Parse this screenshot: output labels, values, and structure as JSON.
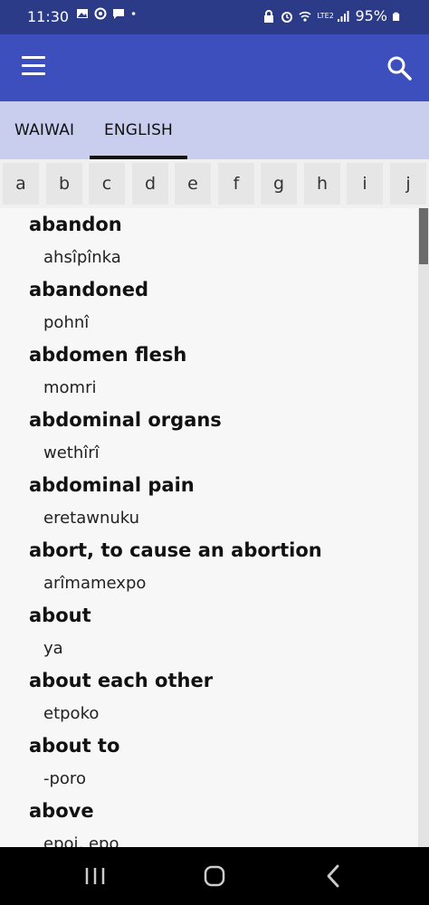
{
  "status": {
    "time": "11:30",
    "battery": "95%",
    "network": "LTE2"
  },
  "appbar": {
    "menu_icon": "hamburger-menu-icon",
    "search_icon": "search-icon"
  },
  "tabs": [
    {
      "label": "WAIWAI",
      "selected": false
    },
    {
      "label": "ENGLISH",
      "selected": true
    }
  ],
  "letters": [
    "a",
    "b",
    "c",
    "d",
    "e",
    "f",
    "g",
    "h",
    "i",
    "j"
  ],
  "entries": [
    {
      "word": "abandon",
      "translation": "ahsîpînka"
    },
    {
      "word": "abandoned",
      "translation": "pohnî"
    },
    {
      "word": "abdomen flesh",
      "translation": "momri"
    },
    {
      "word": "abdominal organs",
      "translation": "wethîrî"
    },
    {
      "word": "abdominal pain",
      "translation": "eretawnuku"
    },
    {
      "word": "abort, to cause an abortion",
      "translation": "arîmamexpo"
    },
    {
      "word": "about",
      "translation": "ya"
    },
    {
      "word": "about each other",
      "translation": "etpoko"
    },
    {
      "word": "about to",
      "translation": "-poro"
    },
    {
      "word": "above",
      "translation": "epoi, epo"
    }
  ],
  "colors": {
    "statusbar": "#2c3b88",
    "appbar": "#3d4fbc",
    "tabs": "#c9cdee"
  }
}
